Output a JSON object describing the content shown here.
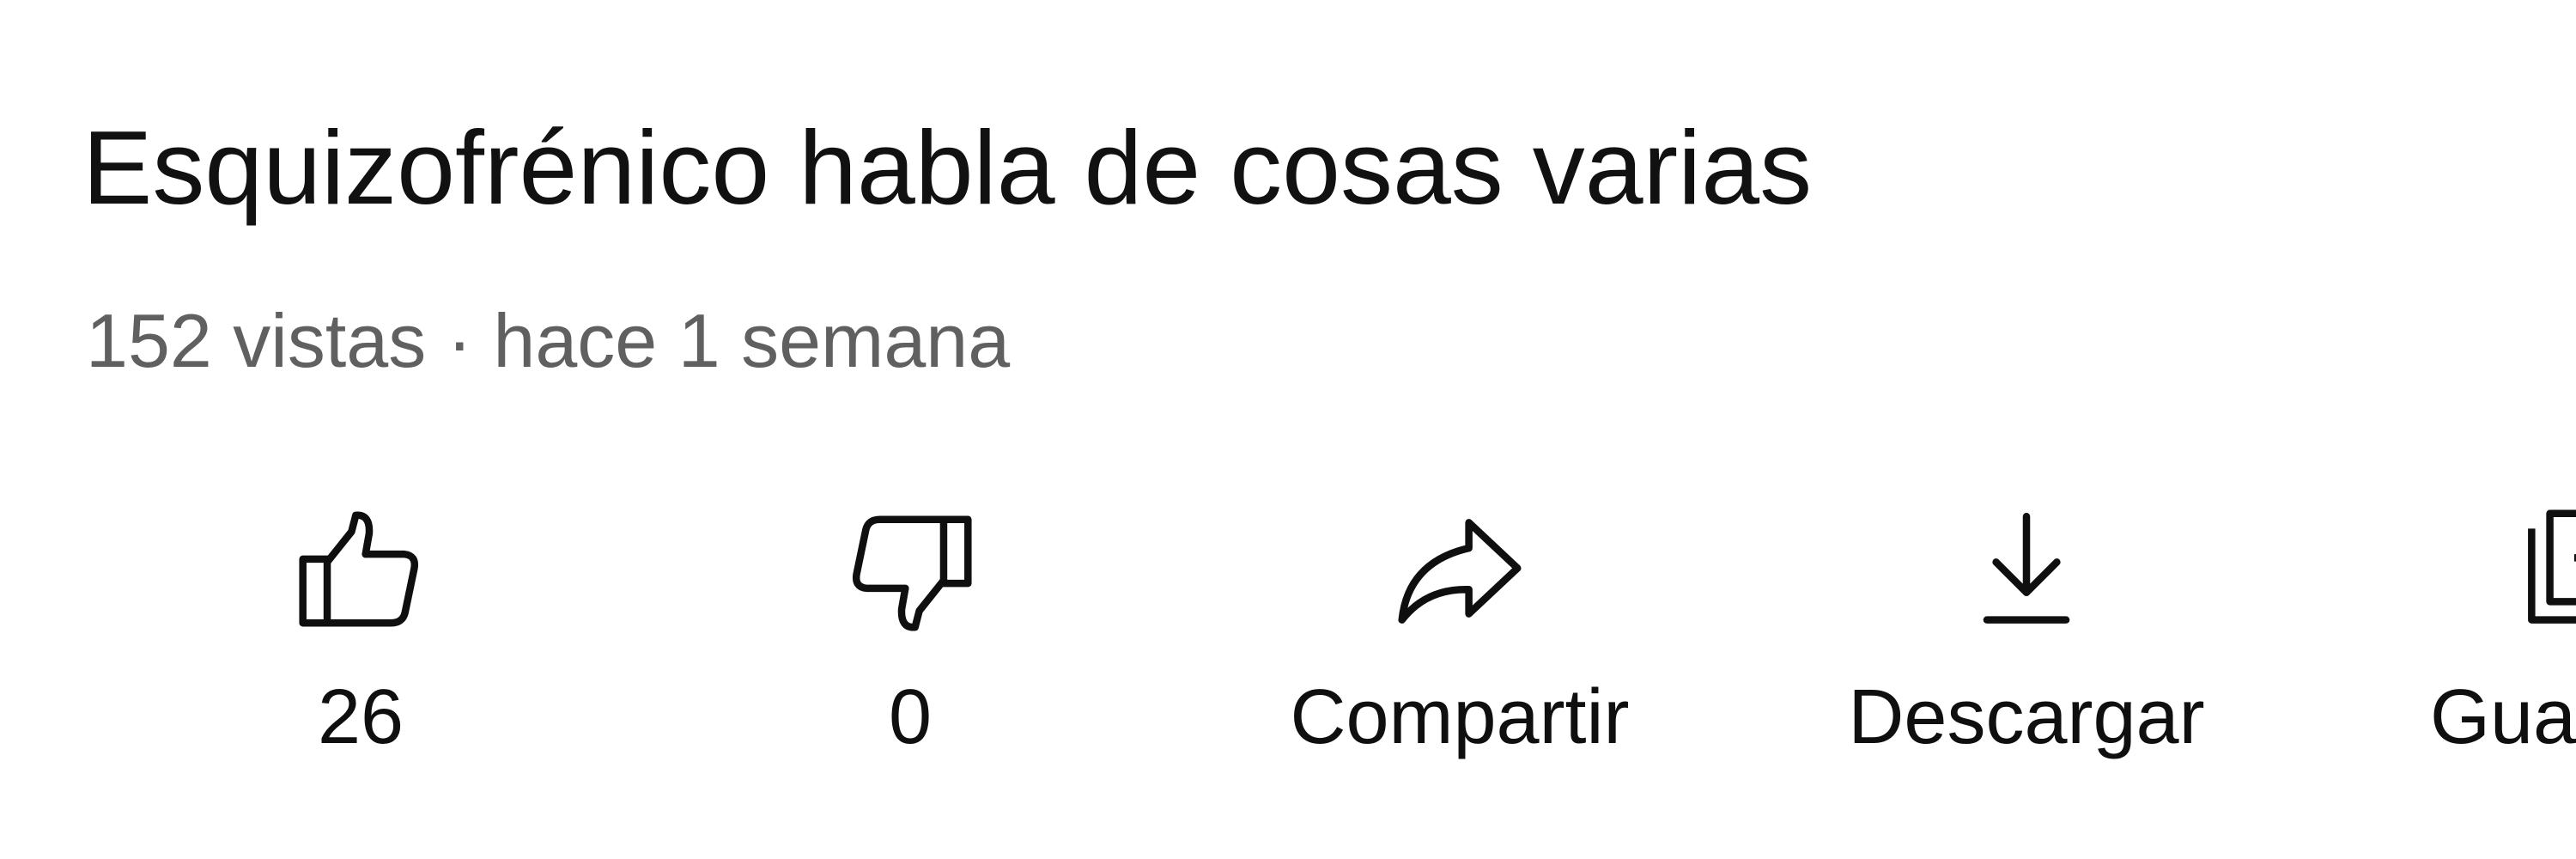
{
  "video": {
    "title": "Esquizofrénico habla de cosas varias",
    "meta": "152 vistas · hace 1 semana"
  },
  "actions": {
    "like": {
      "icon": "thumbs-up-icon",
      "label": "26"
    },
    "dislike": {
      "icon": "thumbs-down-icon",
      "label": "0"
    },
    "share": {
      "icon": "share-arrow-icon",
      "label": "Compartir"
    },
    "download": {
      "icon": "download-icon",
      "label": "Descargar"
    },
    "save": {
      "icon": "playlist-add-icon",
      "label": "Gua"
    }
  },
  "colors": {
    "background": "#ffffff",
    "text": "#0f0f0f",
    "meta_text": "#606060",
    "icon_stroke": "#0f0f0f"
  }
}
